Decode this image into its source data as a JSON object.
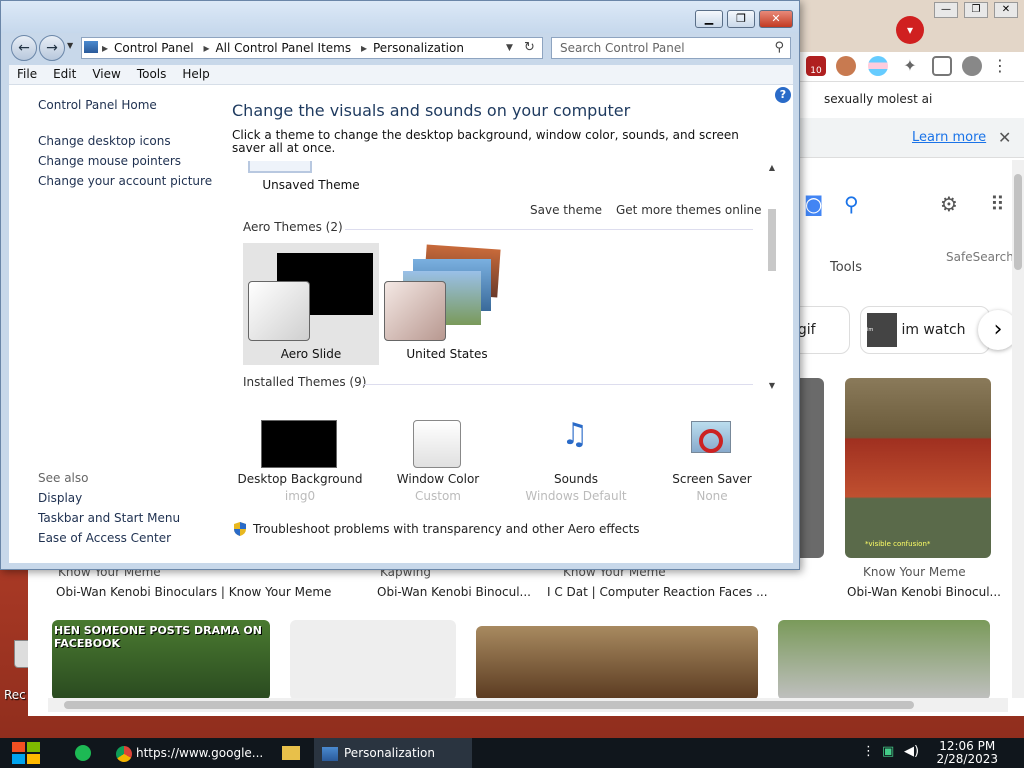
{
  "desktop": {
    "icon_label": "Rec"
  },
  "chrome": {
    "extension_badge": "10",
    "tab_title": "sexually molest ai",
    "info_link": "Learn more",
    "close_symbol": "✕",
    "tools": "Tools",
    "safesearch": "SafeSearch",
    "chips": [
      "er gif",
      "im watch"
    ],
    "results": [
      {
        "source": "Know Your Meme",
        "title": "Obi-Wan Kenobi Binoculars | Know Your Meme"
      },
      {
        "source": "Kapwing",
        "title": "Obi-Wan Kenobi Binocul..."
      },
      {
        "source": "Know Your Meme",
        "title": "I C Dat | Computer Reaction Faces ..."
      },
      {
        "source": "Know Your Meme",
        "title": "Obi-Wan Kenobi Binocul..."
      }
    ],
    "meme_caption": "HEN SOMEONE POSTS DRAMA ON FACEBOOK",
    "thumb_caption": "*visible confusion*",
    "chip_thumb_text": "im watching you"
  },
  "cp": {
    "breadcrumbs": [
      "Control Panel",
      "All Control Panel Items",
      "Personalization"
    ],
    "search_placeholder": "Search Control Panel",
    "menu": [
      "File",
      "Edit",
      "View",
      "Tools",
      "Help"
    ],
    "left_links": [
      "Control Panel Home",
      "Change desktop icons",
      "Change mouse pointers",
      "Change your account picture"
    ],
    "see_also_heading": "See also",
    "see_also_links": [
      "Display",
      "Taskbar and Start Menu",
      "Ease of Access Center"
    ],
    "heading": "Change the visuals and sounds on your computer",
    "subheading": "Click a theme to change the desktop background, window color, sounds, and screen saver all at once.",
    "unsaved_theme": "Unsaved Theme",
    "save_theme": "Save theme",
    "get_more": "Get more themes online",
    "aero_section": "Aero Themes (2)",
    "aero_themes": [
      "Aero Slide",
      "United States"
    ],
    "installed_section": "Installed Themes (9)",
    "bottom": [
      {
        "label": "Desktop Background",
        "sub": "img0"
      },
      {
        "label": "Window Color",
        "sub": "Custom"
      },
      {
        "label": "Sounds",
        "sub": "Windows Default"
      },
      {
        "label": "Screen Saver",
        "sub": "None"
      }
    ],
    "troubleshoot": "Troubleshoot problems with transparency and other Aero effects"
  },
  "taskbar": {
    "items": [
      "https://www.google...",
      "Personalization"
    ],
    "time": "12:06 PM",
    "date": "2/28/2023"
  }
}
